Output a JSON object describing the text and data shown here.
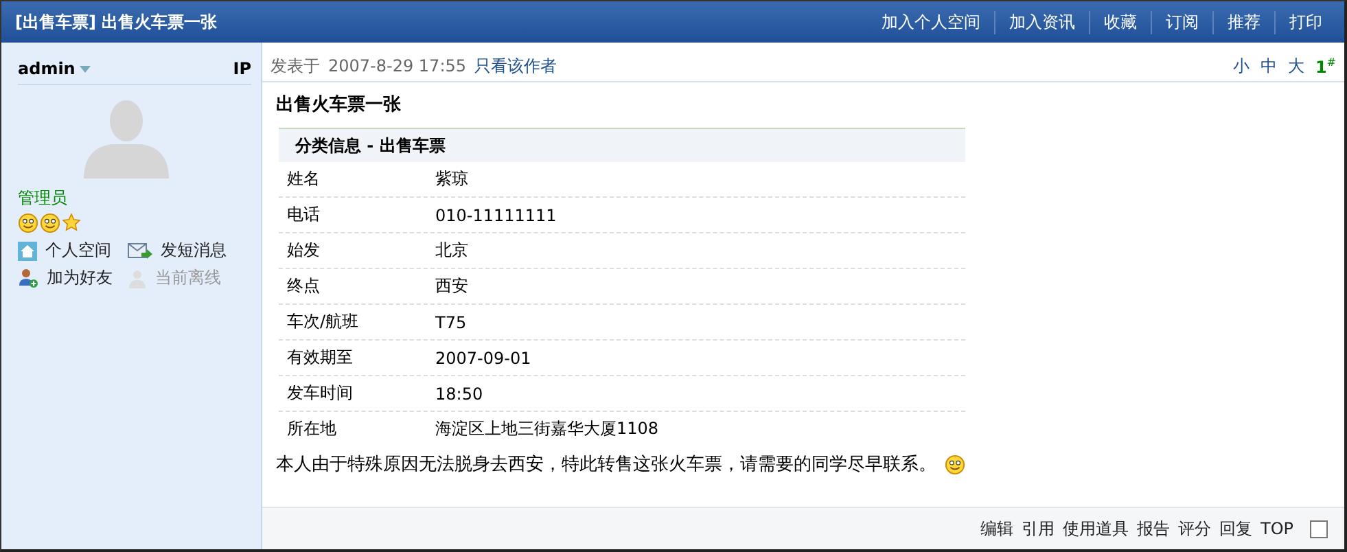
{
  "header": {
    "title": "[出售车票] 出售火车票一张",
    "actions": [
      "加入个人空间",
      "加入资讯",
      "收藏",
      "订阅",
      "推荐",
      "打印"
    ]
  },
  "sidebar": {
    "username": "admin",
    "ip": "IP",
    "group": "管理员",
    "links": [
      {
        "kind": "home",
        "label": "个人空间",
        "disabled": false
      },
      {
        "kind": "message",
        "label": "发短消息",
        "disabled": false
      },
      {
        "kind": "friend",
        "label": "加为好友",
        "disabled": false
      },
      {
        "kind": "status",
        "label": "当前离线",
        "disabled": true
      }
    ]
  },
  "post": {
    "posted_label": "发表于",
    "posted_time": "2007-8-29 17:55",
    "author_only": "只看该作者",
    "font_sizes": [
      "小",
      "中",
      "大"
    ],
    "floor": "1$^{#}$",
    "title": "出售火车票一张",
    "info": {
      "heading": "分类信息  - 出售车票",
      "rows": [
        {
          "label": "姓名",
          "value": "紫琼"
        },
        {
          "label": "电话",
          "value": "010-11111111"
        },
        {
          "label": "始发",
          "value": "北京"
        },
        {
          "label": "终点",
          "value": "西安"
        },
        {
          "label": "车次/航班",
          "value": "T75"
        },
        {
          "label": "有效期至",
          "value": "2007-09-01"
        },
        {
          "label": "发车时间",
          "value": "18:50"
        },
        {
          "label": "所在地",
          "value": "海淀区上地三街嘉华大厦1108"
        }
      ]
    },
    "message": "本人由于特殊原因无法脱身去西安，特此转售这张火车票，请需要的同学尽早联系。",
    "footer_actions": [
      "编辑",
      "引用",
      "使用道具",
      "报告",
      "评分",
      "回复",
      "TOP"
    ],
    "select_checkbox": {
      "checked": false
    }
  }
}
